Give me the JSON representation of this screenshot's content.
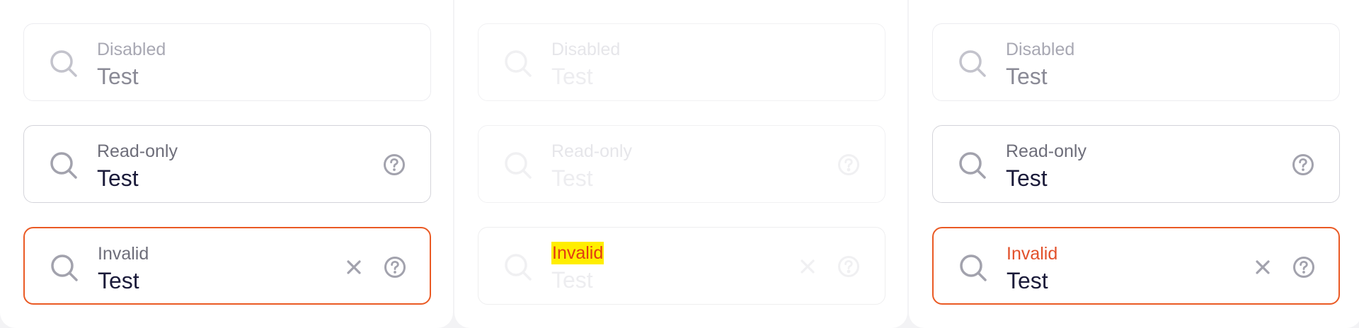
{
  "colors": {
    "border": "#d8d8de",
    "invalid_border": "#ea5a24",
    "label": "#6e6e7a",
    "value": "#1b1b3a",
    "invalid_label": "#e2502a",
    "highlight_bg": "#ffee00"
  },
  "panels": [
    {
      "fields": [
        {
          "label": "Disabled",
          "value": "Test",
          "state": "disabled",
          "icons": [
            "search-icon"
          ]
        },
        {
          "label": "Read-only",
          "value": "Test",
          "state": "readonly",
          "icons": [
            "search-icon",
            "help-icon"
          ]
        },
        {
          "label": "Invalid",
          "value": "Test",
          "state": "invalid",
          "icons": [
            "search-icon",
            "clear-icon",
            "help-icon"
          ]
        }
      ]
    },
    {
      "fields": [
        {
          "label": "Disabled",
          "value": "Test",
          "state": "disabled",
          "icons": [
            "search-icon"
          ]
        },
        {
          "label": "Read-only",
          "value": "Test",
          "state": "readonly",
          "icons": [
            "search-icon",
            "help-icon"
          ]
        },
        {
          "label": "Invalid",
          "value": "Test",
          "state": "invalid",
          "icons": [
            "search-icon",
            "clear-icon",
            "help-icon"
          ]
        }
      ]
    },
    {
      "fields": [
        {
          "label": "Disabled",
          "value": "Test",
          "state": "disabled",
          "icons": [
            "search-icon"
          ]
        },
        {
          "label": "Read-only",
          "value": "Test",
          "state": "readonly",
          "icons": [
            "search-icon",
            "help-icon"
          ]
        },
        {
          "label": "Invalid",
          "value": "Test",
          "state": "invalid",
          "icons": [
            "search-icon",
            "clear-icon",
            "help-icon"
          ]
        }
      ]
    }
  ]
}
